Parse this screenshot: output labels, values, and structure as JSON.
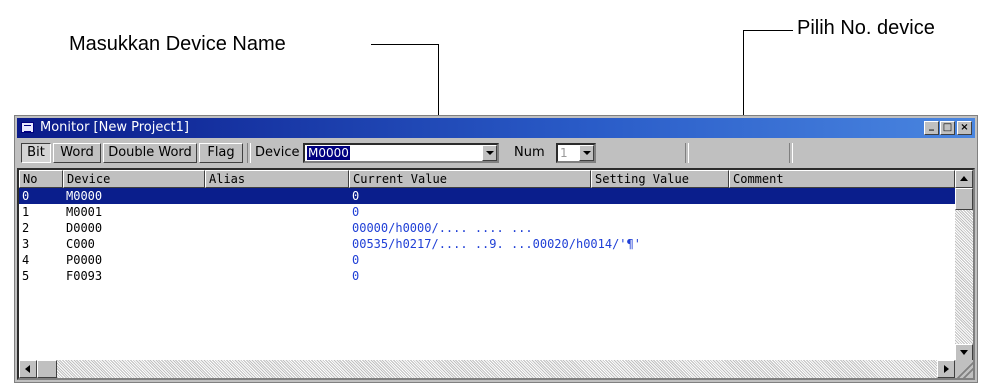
{
  "annotations": {
    "device_name_label": "Masukkan Device Name",
    "device_no_label": "Pilih  No. device"
  },
  "window": {
    "title": "Monitor [New Project1]",
    "minimize_label": "_",
    "maximize_label": "□",
    "close_label": "×"
  },
  "toolbar": {
    "tabs": [
      "Bit",
      "Word",
      "Double Word",
      "Flag"
    ],
    "active_tab": "Bit",
    "device_label": "Device",
    "device_value": "M0000",
    "num_label": "Num",
    "num_value": "1"
  },
  "table": {
    "columns": [
      "No",
      "Device",
      "Alias",
      "Current Value",
      "Setting Value",
      "Comment"
    ],
    "rows": [
      {
        "no": "0",
        "device": "M0000",
        "alias": "",
        "current": "0",
        "setting": "",
        "comment": ""
      },
      {
        "no": "1",
        "device": "M0001",
        "alias": "",
        "current": "0",
        "setting": "",
        "comment": ""
      },
      {
        "no": "2",
        "device": "D0000",
        "alias": "",
        "current": "00000/h0000/.... .... ...",
        "setting": "",
        "comment": ""
      },
      {
        "no": "3",
        "device": "C000",
        "alias": "",
        "current": "00535/h0217/.... ..9. ...00020/h0014/'¶'",
        "setting": "",
        "comment": ""
      },
      {
        "no": "4",
        "device": "P0000",
        "alias": "",
        "current": "0",
        "setting": "",
        "comment": ""
      },
      {
        "no": "5",
        "device": "F0093",
        "alias": "",
        "current": "0",
        "setting": "",
        "comment": ""
      }
    ],
    "selected_row": "0"
  },
  "colors": {
    "selection": "#0a1e8c",
    "value_text": "#1f3fd6",
    "titlebar": "#0a1a8a"
  }
}
